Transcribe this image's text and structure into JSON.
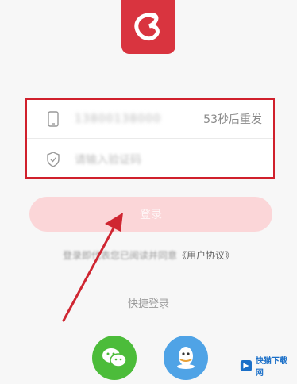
{
  "phone_field": {
    "value": "13800138000",
    "resend_label": "53秒后重发"
  },
  "code_field": {
    "placeholder": "请输入验证码"
  },
  "login_button": {
    "label": "登录"
  },
  "agreement": {
    "prefix": "登录即代表您已阅读并同意",
    "link": "《用户协议》"
  },
  "quick_login": {
    "label": "快捷登录"
  },
  "watermark": {
    "text": "快猫下载网"
  },
  "colors": {
    "brand": "#d9343f",
    "highlight_border": "#d0202c",
    "wechat": "#4cbc3a",
    "qq": "#4fa3e6"
  }
}
